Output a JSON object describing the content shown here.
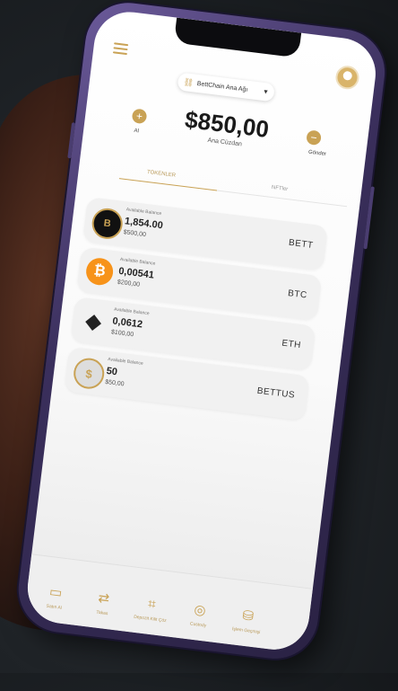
{
  "network": {
    "label": "BettChain Ana Ağı"
  },
  "wallet": {
    "balance": "$850,00",
    "label": "Ana Cüzdan",
    "receive_label": "Al",
    "send_label": "Gönder"
  },
  "tabs": [
    {
      "label": "TOKENLER",
      "active": true
    },
    {
      "label": "NFTler",
      "active": false
    }
  ],
  "assets": [
    {
      "label": "Available Balance",
      "amount": "1,854.00",
      "usd": "$500,00",
      "symbol": "BETT",
      "icon": "bett-coin-icon",
      "color": "#111111"
    },
    {
      "label": "Available Balance",
      "amount": "0,00541",
      "usd": "$200,00",
      "symbol": "BTC",
      "icon": "bitcoin-icon",
      "color": "#f7931a"
    },
    {
      "label": "Available Balance",
      "amount": "0,0612",
      "usd": "$100,00",
      "symbol": "ETH",
      "icon": "ethereum-icon",
      "color": "#3c3c3d"
    },
    {
      "label": "Available Balance",
      "amount": "50",
      "usd": "$50,00",
      "symbol": "BETTUS",
      "icon": "bettus-coin-icon",
      "color": "#c9a255"
    }
  ],
  "nav": [
    {
      "label": "Satın Al",
      "icon": "wallet-icon"
    },
    {
      "label": "Takas",
      "icon": "swap-icon"
    },
    {
      "label": "Depozit Kilit Çöz",
      "icon": "unlock-icon"
    },
    {
      "label": "Custody",
      "icon": "custody-icon"
    },
    {
      "label": "İşlem Geçmişi",
      "icon": "history-icon"
    }
  ],
  "accent": "#c9a255"
}
